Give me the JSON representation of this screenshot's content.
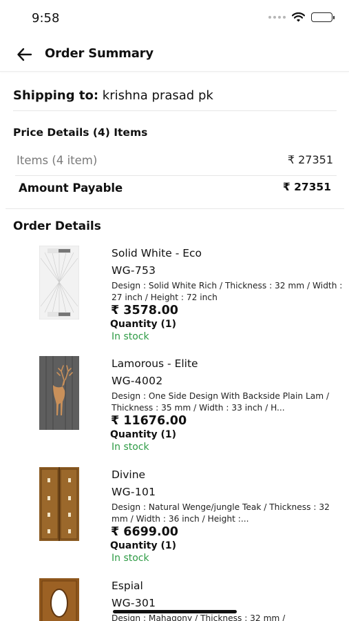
{
  "status_bar": {
    "time": "9:58"
  },
  "header": {
    "title": "Order Summary"
  },
  "shipping": {
    "label": "Shipping to:",
    "name": "krishna prasad pk"
  },
  "price_details": {
    "title": "Price Details (4) Items",
    "items_label": "Items (4 item)",
    "items_value": "₹  27351",
    "amount_label": "Amount Payable",
    "amount_value": "₹ 27351"
  },
  "order_details": {
    "title": "Order Details",
    "items": [
      {
        "name": "Solid White - Eco",
        "code": "WG-753",
        "description": "Design : Solid White Rich / Thickness : 32 mm / Width : 27 inch / Height : 72 inch",
        "price": "₹ 3578.00",
        "quantity": "Quantity (1)",
        "stock": "In stock",
        "thumbnail_icon": "white-door-thumbnail"
      },
      {
        "name": "Lamorous - Elite",
        "code": "WG-4002",
        "description": "Design : One Side Design With Backside Plain Lam / Thickness : 35 mm / Width : 33 inch / H...",
        "price": "₹ 11676.00",
        "quantity": "Quantity (1)",
        "stock": "In stock",
        "thumbnail_icon": "deer-door-thumbnail"
      },
      {
        "name": "Divine",
        "code": "WG-101",
        "description": "Design : Natural Wenge/jungle Teak / Thickness : 32 mm / Width : 36 inch / Height :...",
        "price": "₹ 6699.00",
        "quantity": "Quantity (1)",
        "stock": "In stock",
        "thumbnail_icon": "teak-door-thumbnail"
      },
      {
        "name": "Espial",
        "code": "WG-301",
        "description": "Design : Mahagony / Thickness : 32 mm /",
        "price": "",
        "quantity": "",
        "stock": "",
        "thumbnail_icon": "oval-glass-door-thumbnail"
      }
    ]
  },
  "colors": {
    "in_stock": "#2e9b45",
    "text": "#111111",
    "muted": "#7a7a7a",
    "divider": "#e6e6e6"
  }
}
